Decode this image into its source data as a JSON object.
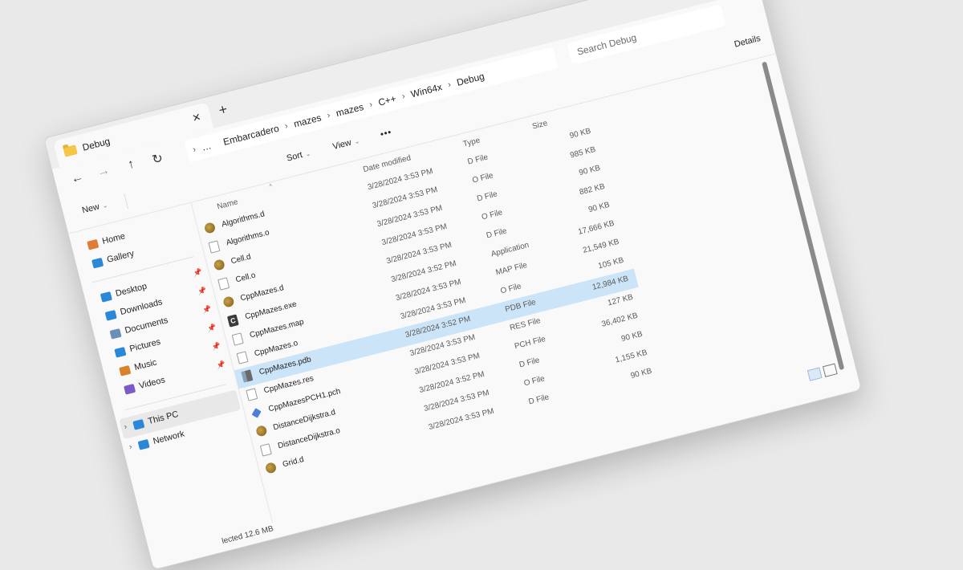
{
  "tab": {
    "title": "Debug",
    "close": "✕",
    "new_tab": "+"
  },
  "nav": {
    "back": "←",
    "forward": "→",
    "up": "↑",
    "refresh": "↻",
    "address": [
      "…",
      "Embarcadero",
      "mazes",
      "mazes",
      "C++",
      "Win64x",
      "Debug"
    ],
    "search_placeholder": "Search Debug"
  },
  "commands": {
    "new": "New",
    "sort": "Sort",
    "view": "View",
    "more": "•••",
    "details": "Details"
  },
  "sidebar": {
    "top": [
      {
        "label": "Home",
        "icon": "home-icon",
        "color": "#e07b39"
      },
      {
        "label": "Gallery",
        "icon": "gallery-icon",
        "color": "#2b88d8"
      }
    ],
    "pinned": [
      {
        "label": "Desktop",
        "icon": "desktop-icon",
        "color": "#2b88d8"
      },
      {
        "label": "Downloads",
        "icon": "downloads-icon",
        "color": "#2b88d8"
      },
      {
        "label": "Documents",
        "icon": "documents-icon",
        "color": "#6c8fb5"
      },
      {
        "label": "Pictures",
        "icon": "pictures-icon",
        "color": "#2b88d8"
      },
      {
        "label": "Music",
        "icon": "music-icon",
        "color": "#d9822b"
      },
      {
        "label": "Videos",
        "icon": "videos-icon",
        "color": "#7a5cc4"
      }
    ],
    "pin_glyph": "📌",
    "bottom": [
      {
        "label": "This PC",
        "icon": "this-pc-icon",
        "color": "#2b88d8"
      },
      {
        "label": "Network",
        "icon": "network-icon",
        "color": "#2b88d8"
      }
    ],
    "chevron": "›"
  },
  "columns": {
    "name": "Name",
    "date": "Date modified",
    "type": "Type",
    "size": "Size"
  },
  "files": [
    {
      "name": "Algorithms.d",
      "date": "3/28/2024 3:53 PM",
      "type": "D File",
      "size": "90 KB",
      "icon": "d"
    },
    {
      "name": "Algorithms.o",
      "date": "3/28/2024 3:53 PM",
      "type": "O File",
      "size": "985 KB",
      "icon": "o"
    },
    {
      "name": "Cell.d",
      "date": "3/28/2024 3:53 PM",
      "type": "D File",
      "size": "90 KB",
      "icon": "d"
    },
    {
      "name": "Cell.o",
      "date": "3/28/2024 3:53 PM",
      "type": "O File",
      "size": "882 KB",
      "icon": "o"
    },
    {
      "name": "CppMazes.d",
      "date": "3/28/2024 3:53 PM",
      "type": "D File",
      "size": "90 KB",
      "icon": "d"
    },
    {
      "name": "CppMazes.exe",
      "date": "3/28/2024 3:52 PM",
      "type": "Application",
      "size": "17,666 KB",
      "icon": "exe"
    },
    {
      "name": "CppMazes.map",
      "date": "3/28/2024 3:53 PM",
      "type": "MAP File",
      "size": "21,549 KB",
      "icon": "o"
    },
    {
      "name": "CppMazes.o",
      "date": "3/28/2024 3:53 PM",
      "type": "O File",
      "size": "105 KB",
      "icon": "o"
    },
    {
      "name": "CppMazes.pdb",
      "date": "3/28/2024 3:52 PM",
      "type": "PDB File",
      "size": "12,984 KB",
      "icon": "pdb",
      "selected": true
    },
    {
      "name": "CppMazes.res",
      "date": "3/28/2024 3:53 PM",
      "type": "RES File",
      "size": "127 KB",
      "icon": "o"
    },
    {
      "name": "CppMazesPCH1.pch",
      "date": "3/28/2024 3:53 PM",
      "type": "PCH File",
      "size": "36,402 KB",
      "icon": "pch"
    },
    {
      "name": "DistanceDijkstra.d",
      "date": "3/28/2024 3:52 PM",
      "type": "D File",
      "size": "90 KB",
      "icon": "d"
    },
    {
      "name": "DistanceDijkstra.o",
      "date": "3/28/2024 3:53 PM",
      "type": "O File",
      "size": "1,155 KB",
      "icon": "o"
    },
    {
      "name": "Grid.d",
      "date": "3/28/2024 3:53 PM",
      "type": "D File",
      "size": "90 KB",
      "icon": "d"
    }
  ],
  "status": {
    "selected": "lected 12.6 MB"
  }
}
